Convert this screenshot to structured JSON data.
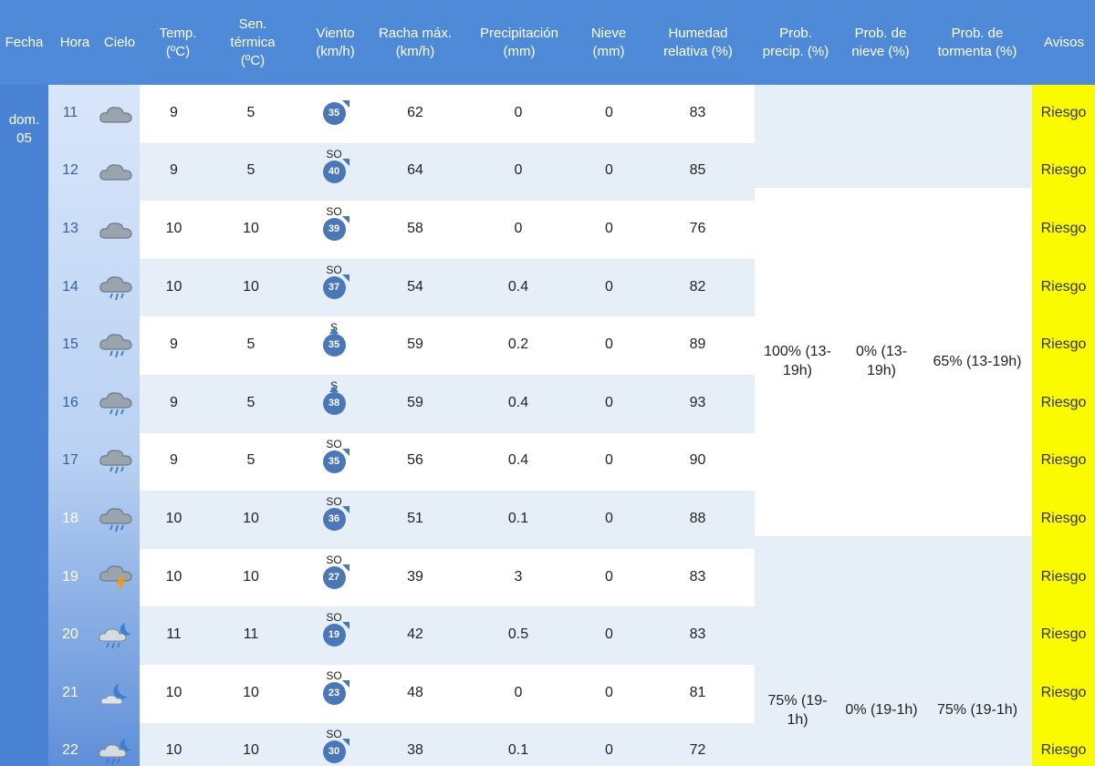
{
  "headers": {
    "fecha": "Fecha",
    "hora": "Hora",
    "cielo": "Cielo",
    "temp": "Temp.\n(ºC)",
    "sen": "Sen.\ntérmica\n(ºC)",
    "viento": "Viento\n(km/h)",
    "racha": "Racha máx.\n(km/h)",
    "precip": "Precipitación\n(mm)",
    "nieve": "Nieve\n(mm)",
    "humedad": "Humedad\nrelativa (%)",
    "prob_precip": "Prob.\nprecip. (%)",
    "prob_nieve": "Prob. de\nnieve (%)",
    "prob_tormenta": "Prob. de\ntormenta (%)",
    "avisos": "Avisos"
  },
  "fecha": "dom.\n05",
  "rows": [
    {
      "hora": "11",
      "cielo": "cloudy-icon",
      "temp": "9",
      "sen": "5",
      "dir": "",
      "wind": "35",
      "racha": "62",
      "precip": "0",
      "nieve": "0",
      "humedad": "83",
      "aviso": "Riesgo"
    },
    {
      "hora": "12",
      "cielo": "cloudy-icon",
      "temp": "9",
      "sen": "5",
      "dir": "SO",
      "wind": "40",
      "racha": "64",
      "precip": "0",
      "nieve": "0",
      "humedad": "85",
      "aviso": "Riesgo"
    },
    {
      "hora": "13",
      "cielo": "cloudy-icon",
      "temp": "10",
      "sen": "10",
      "dir": "SO",
      "wind": "39",
      "racha": "58",
      "precip": "0",
      "nieve": "0",
      "humedad": "76",
      "aviso": "Riesgo"
    },
    {
      "hora": "14",
      "cielo": "rain-cloud-icon",
      "temp": "10",
      "sen": "10",
      "dir": "SO",
      "wind": "37",
      "racha": "54",
      "precip": "0.4",
      "nieve": "0",
      "humedad": "82",
      "aviso": "Riesgo"
    },
    {
      "hora": "15",
      "cielo": "rain-cloud-icon",
      "temp": "9",
      "sen": "5",
      "dir": "S",
      "wind": "35",
      "racha": "59",
      "precip": "0.2",
      "nieve": "0",
      "humedad": "89",
      "aviso": "Riesgo"
    },
    {
      "hora": "16",
      "cielo": "rain-cloud-icon",
      "temp": "9",
      "sen": "5",
      "dir": "S",
      "wind": "38",
      "racha": "59",
      "precip": "0.4",
      "nieve": "0",
      "humedad": "93",
      "aviso": "Riesgo"
    },
    {
      "hora": "17",
      "cielo": "rain-cloud-icon",
      "temp": "9",
      "sen": "5",
      "dir": "SO",
      "wind": "35",
      "racha": "56",
      "precip": "0.4",
      "nieve": "0",
      "humedad": "90",
      "aviso": "Riesgo"
    },
    {
      "hora": "18",
      "cielo": "rain-cloud-icon",
      "temp": "10",
      "sen": "10",
      "dir": "SO",
      "wind": "36",
      "racha": "51",
      "precip": "0.1",
      "nieve": "0",
      "humedad": "88",
      "aviso": "Riesgo"
    },
    {
      "hora": "19",
      "cielo": "storm-cloud-icon",
      "temp": "10",
      "sen": "10",
      "dir": "SO",
      "wind": "27",
      "racha": "39",
      "precip": "3",
      "nieve": "0",
      "humedad": "83",
      "aviso": "Riesgo"
    },
    {
      "hora": "20",
      "cielo": "night-rain-icon",
      "temp": "11",
      "sen": "11",
      "dir": "SO",
      "wind": "19",
      "racha": "42",
      "precip": "0.5",
      "nieve": "0",
      "humedad": "83",
      "aviso": "Riesgo"
    },
    {
      "hora": "21",
      "cielo": "moon-cloud-icon",
      "temp": "10",
      "sen": "10",
      "dir": "SO",
      "wind": "23",
      "racha": "48",
      "precip": "0",
      "nieve": "0",
      "humedad": "81",
      "aviso": "Riesgo"
    },
    {
      "hora": "22",
      "cielo": "night-rain-icon",
      "temp": "10",
      "sen": "10",
      "dir": "SO",
      "wind": "30",
      "racha": "38",
      "precip": "0.1",
      "nieve": "0",
      "humedad": "72",
      "aviso": "Riesgo"
    }
  ],
  "prob_groups": [
    {
      "precip": "",
      "nieve": "",
      "tormenta": ""
    },
    {
      "precip": "100% (13-\n19h)",
      "nieve": "0% (13-\n19h)",
      "tormenta": "65% (13-19h)"
    },
    {
      "precip": "75% (19-\n1h)",
      "nieve": "0% (19-1h)",
      "tormenta": "75% (19-1h)"
    }
  ],
  "colors": {
    "header_bg": "#4f8ad8",
    "row_alt": "#e6eff8",
    "avisos_bg": "#fafa00",
    "wind_badge": "#4b77b8"
  }
}
